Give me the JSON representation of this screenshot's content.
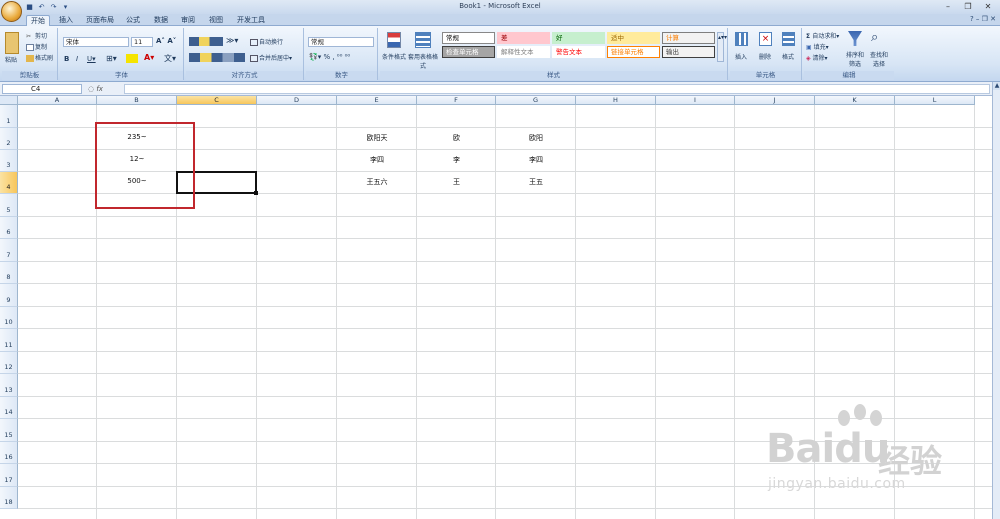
{
  "window": {
    "title": "Book1 - Microsoft Excel"
  },
  "ribbon_tabs": [
    "开始",
    "插入",
    "页面布局",
    "公式",
    "数据",
    "审阅",
    "视图",
    "开发工具"
  ],
  "clipboard": {
    "paste": "粘贴",
    "cut": "剪切",
    "copy": "复制",
    "format_painter": "格式刷",
    "label": "剪贴板"
  },
  "font": {
    "name": "宋体",
    "size": "11",
    "label": "字体"
  },
  "alignment": {
    "wrap": "自动换行",
    "merge": "合并后居中",
    "label": "对齐方式"
  },
  "number": {
    "format": "常规",
    "label": "数字"
  },
  "styles": {
    "conditional": "条件格式",
    "table": "套用表格格式",
    "label": "样式",
    "cells": [
      {
        "text": "常规",
        "bg": "#ffffff",
        "color": "#000000",
        "border": "#888888"
      },
      {
        "text": "差",
        "bg": "#ffc7ce",
        "color": "#9c0006",
        "border": "#ffc7ce"
      },
      {
        "text": "好",
        "bg": "#c6efce",
        "color": "#006100",
        "border": "#c6efce"
      },
      {
        "text": "适中",
        "bg": "#ffeb9c",
        "color": "#9c6500",
        "border": "#ffeb9c"
      },
      {
        "text": "计算",
        "bg": "#f2f2f2",
        "color": "#fa7d00",
        "border": "#7f7f7f"
      },
      {
        "text": "检查单元格",
        "bg": "#a5a5a5",
        "color": "#ffffff",
        "border": "#3f3f3f"
      },
      {
        "text": "解释性文本",
        "bg": "#ffffff",
        "color": "#7f7f7f",
        "border": "#ffffff"
      },
      {
        "text": "警告文本",
        "bg": "#ffffff",
        "color": "#ff0000",
        "border": "#ffffff"
      },
      {
        "text": "链接单元格",
        "bg": "#ffffff",
        "color": "#fa7d00",
        "border": "#ff8001"
      },
      {
        "text": "输出",
        "bg": "#f2f2f2",
        "color": "#3f3f3f",
        "border": "#3f3f3f"
      }
    ]
  },
  "cells_group": {
    "insert": "插入",
    "delete": "删除",
    "format": "格式",
    "label": "单元格"
  },
  "editing": {
    "autosum": "自动求和",
    "fill": "填充",
    "clear": "清除",
    "sort": "排序和筛选",
    "find": "查找和选择",
    "label": "编辑"
  },
  "formula_bar": {
    "name_box": "C4",
    "fx": "fx",
    "content": ""
  },
  "columns": [
    "A",
    "B",
    "C",
    "D",
    "E",
    "F",
    "G",
    "H",
    "I",
    "J",
    "K",
    "L"
  ],
  "rows": [
    "1",
    "2",
    "3",
    "4",
    "5",
    "6",
    "7",
    "8",
    "9",
    "10",
    "11",
    "12",
    "13",
    "14",
    "15",
    "16",
    "17",
    "18"
  ],
  "cells": {
    "B2": "235~",
    "B3": "12~",
    "B4": "500~",
    "E2": "欧阳天",
    "E3": "李四",
    "E4": "王五六",
    "F2": "欧",
    "F3": "李",
    "F4": "王",
    "G2": "欧阳",
    "G3": "李四",
    "G4": "王五"
  },
  "watermark": {
    "brand": "Baidu",
    "cn": "经验",
    "url": "jingyan.baidu.com"
  }
}
